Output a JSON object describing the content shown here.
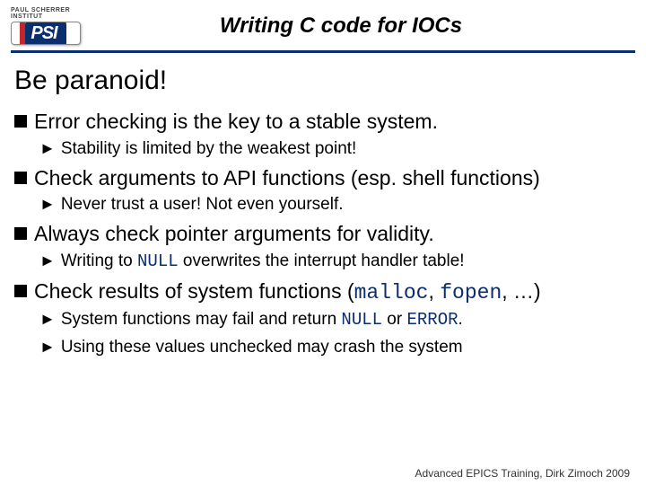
{
  "logo": {
    "institute": "PAUL SCHERRER INSTITUT",
    "abbrev": "PSI"
  },
  "title": "Writing C code for IOCs",
  "heading": "Be paranoid!",
  "bullets": [
    {
      "text": "Error checking is the key to a stable system.",
      "sub": [
        {
          "text": "Stability is limited by the weakest point!"
        }
      ]
    },
    {
      "text": "Check arguments to API functions (esp. shell functions)",
      "sub": [
        {
          "text": "Never trust a user! Not even yourself."
        }
      ]
    },
    {
      "text": "Always check pointer arguments for validity.",
      "sub": [
        {
          "pre": "Writing to ",
          "code": "NULL",
          "post": " overwrites the interrupt handler table!"
        }
      ]
    },
    {
      "pre": "Check results of system functions (",
      "code1": "malloc",
      "mid": ", ",
      "code2": "fopen",
      "post": ", …)",
      "sub": [
        {
          "pre": "System functions may fail and return ",
          "code": "NULL",
          "mid": " or ",
          "code2": "ERROR",
          "post": "."
        },
        {
          "pre": "Using these values unchecked may crash the system"
        }
      ]
    }
  ],
  "footer": "Advanced EPICS Training, Dirk Zimoch 2009"
}
